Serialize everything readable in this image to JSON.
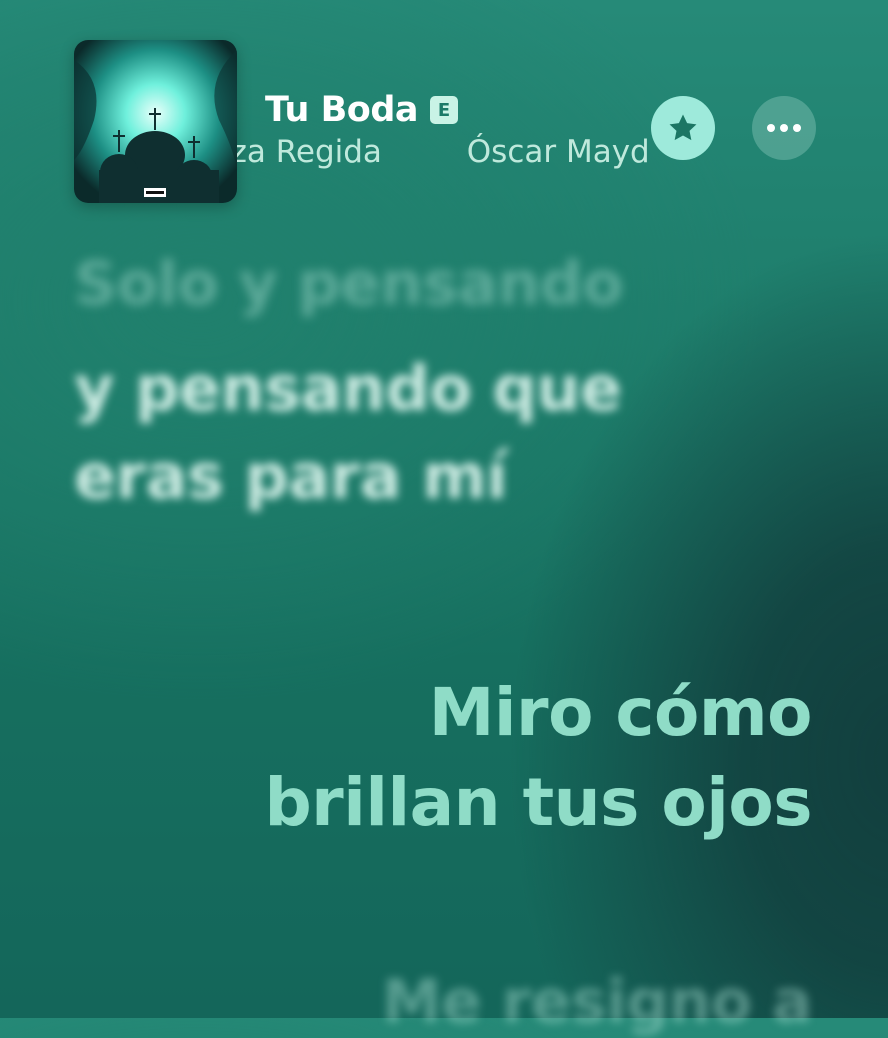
{
  "now_playing": {
    "title": "Tu Boda",
    "explicit_badge": "E",
    "artists": [
      "Fuerza Regida",
      "Óscar Maydon"
    ],
    "favorite_icon": "star-icon",
    "more_icon": "ellipsis-icon"
  },
  "lyrics": {
    "past_line_1": "Solo y pensando",
    "past_line_2": "y pensando que eras para mí",
    "current_line": "Miro cómo brillan tus ojos",
    "next_line": "Me resigno a"
  },
  "colors": {
    "background": "#1d7c6a",
    "accent": "#9eeadb",
    "current_lyric": "#8fdcc7"
  }
}
